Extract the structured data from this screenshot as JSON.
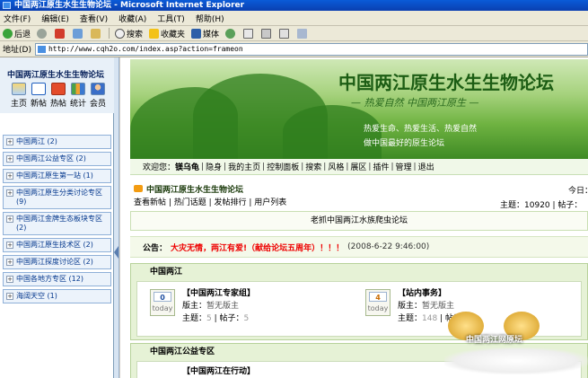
{
  "window": {
    "title": "中国两江原生水生生物论坛 - Microsoft Internet Explorer"
  },
  "menu": [
    "文件(F)",
    "编辑(E)",
    "查看(V)",
    "收藏(A)",
    "工具(T)",
    "帮助(H)"
  ],
  "toolbar": {
    "back": "后退",
    "search": "搜索",
    "favorites": "收藏夹",
    "media": "媒体"
  },
  "address": {
    "label": "地址(D)",
    "url": "http://www.cqh2o.com/index.asp?action=frameon"
  },
  "sidebar": {
    "title": "中国两江原生水生生物论坛",
    "icons": [
      {
        "label": "主页",
        "icon": "home-icon"
      },
      {
        "label": "新帖",
        "icon": "new-icon"
      },
      {
        "label": "热帖",
        "icon": "hot-icon"
      },
      {
        "label": "统计",
        "icon": "stats-icon"
      },
      {
        "label": "会员",
        "icon": "member-icon"
      }
    ],
    "items": [
      {
        "label": "中国两江",
        "count": "(2)"
      },
      {
        "label": "中国两江公益专区",
        "count": "(2)"
      },
      {
        "label": "中国两江原生第一站",
        "count": "(1)"
      },
      {
        "label": "中国两江原生分类讨论专区",
        "count": "(9)"
      },
      {
        "label": "中国两江金牌生态板块专区",
        "count": "(2)"
      },
      {
        "label": "中国两江原生技术区",
        "count": "(2)"
      },
      {
        "label": "中国两江探度讨论区",
        "count": "(2)"
      },
      {
        "label": "中国各地方专区",
        "count": "(12)"
      },
      {
        "label": "海阔天空",
        "count": "(1)"
      }
    ]
  },
  "banner": {
    "title": "中国两江原生水生生物论坛",
    "motto": "— 热爱自然 中国两江原生 —",
    "slogan1": "热爱生命、热爱生活、热爱自然",
    "slogan2": "做中国最好的原生论坛"
  },
  "nav": {
    "welcome": "欢迎您：",
    "user": "镁乌龟",
    "links": [
      "隐身",
      "我的主页",
      "控制面板",
      "搜索",
      "风格",
      "展区",
      "插件",
      "管理",
      "退出"
    ]
  },
  "forum": {
    "title": "中国两江原生水生生物论坛",
    "links": "查看新帖 | 热门话题 | 发帖排行 | 用户列表",
    "today": "今日：",
    "topics_label": "主题：",
    "topics": "10920",
    "posts_label": "| 帖子："
  },
  "ticker": "老抓中国两江水族爬虫论坛",
  "notice": {
    "label": "公告：",
    "text": "大灾无情，两江有爱!（献给论坛五周年）！！！",
    "date": "(2008-6-22 9:46:00)"
  },
  "sections": [
    {
      "name": "中国两江",
      "boards": [
        {
          "name": "【中国两江专家组】",
          "count": "0",
          "today": "today",
          "mod_label": "版主：",
          "mod": "暂无版主",
          "stat_label": "主题：",
          "topics": "5",
          "posts_label": "| 帖子：",
          "posts": "5"
        },
        {
          "name": "【站内事务】",
          "count": "4",
          "today": "today",
          "mod_label": "版主：",
          "mod": "暂无版主",
          "stat_label": "主题：",
          "topics": "148",
          "posts_label": "| 帖子：",
          "posts": ""
        }
      ]
    },
    {
      "name": "中国两江公益专区",
      "boards": [
        {
          "name": "【中国两江在行动】"
        }
      ]
    }
  ],
  "watermark": {
    "text": "中国两江网原坛"
  }
}
